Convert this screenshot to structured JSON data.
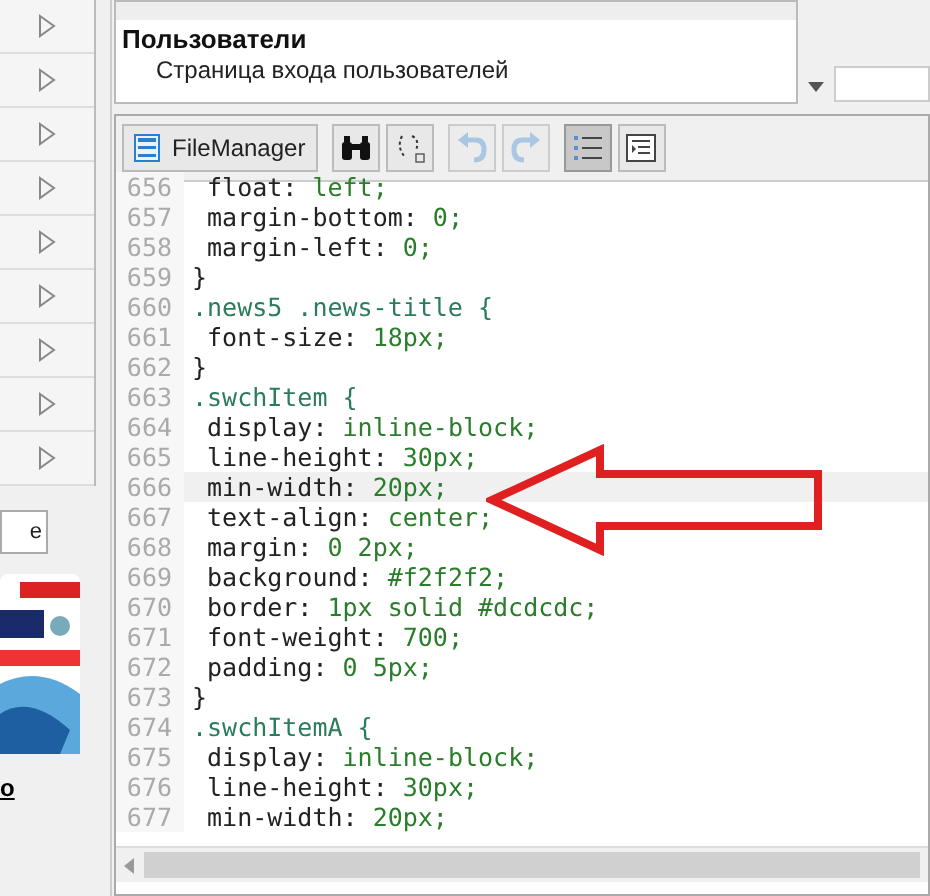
{
  "sidebar": {
    "tab_label": "e",
    "link": "o"
  },
  "pages_list": {
    "items": [
      {
        "kind": "group",
        "text": "Пользователи",
        "selected": false
      },
      {
        "kind": "item",
        "text": "Страница входа пользователей",
        "selected": false
      }
    ]
  },
  "toolbar": {
    "file_manager": "FileManager"
  },
  "editor": {
    "lines": [
      {
        "number": "656",
        "kind": "decl",
        "property": "float:",
        "value": "left;",
        "highlighted": false
      },
      {
        "number": "657",
        "kind": "decl",
        "property": "margin-bottom:",
        "value": "0;",
        "highlighted": false
      },
      {
        "number": "658",
        "kind": "decl",
        "property": "margin-left:",
        "value": "0;",
        "highlighted": false
      },
      {
        "number": "659",
        "kind": "close",
        "text": "}",
        "highlighted": false
      },
      {
        "number": "660",
        "kind": "selector",
        "text": ".news5 .news-title {",
        "highlighted": false
      },
      {
        "number": "661",
        "kind": "decl",
        "property": "font-size:",
        "value": "18px;",
        "highlighted": false
      },
      {
        "number": "662",
        "kind": "close",
        "text": "}",
        "highlighted": false
      },
      {
        "number": "663",
        "kind": "selector",
        "text": ".swchItem {",
        "highlighted": false
      },
      {
        "number": "664",
        "kind": "decl",
        "property": "display:",
        "value": "inline-block;",
        "highlighted": false
      },
      {
        "number": "665",
        "kind": "decl",
        "property": "line-height:",
        "value": "30px;",
        "highlighted": false
      },
      {
        "number": "666",
        "kind": "decl",
        "property": "min-width:",
        "value": "20px;",
        "highlighted": true
      },
      {
        "number": "667",
        "kind": "decl",
        "property": "text-align:",
        "value": "center;",
        "highlighted": false
      },
      {
        "number": "668",
        "kind": "decl",
        "property": "margin:",
        "value": "0 2px;",
        "highlighted": false
      },
      {
        "number": "669",
        "kind": "decl",
        "property": "background:",
        "value": "#f2f2f2;",
        "highlighted": false
      },
      {
        "number": "670",
        "kind": "decl",
        "property": "border:",
        "value": "1px solid #dcdcdc;",
        "highlighted": false
      },
      {
        "number": "671",
        "kind": "decl",
        "property": "font-weight:",
        "value": "700;",
        "highlighted": false
      },
      {
        "number": "672",
        "kind": "decl",
        "property": "padding:",
        "value": "0 5px;",
        "highlighted": false
      },
      {
        "number": "673",
        "kind": "close",
        "text": "}",
        "highlighted": false
      },
      {
        "number": "674",
        "kind": "selector",
        "text": ".swchItemA {",
        "highlighted": false
      },
      {
        "number": "675",
        "kind": "decl",
        "property": "display:",
        "value": "inline-block;",
        "highlighted": false
      },
      {
        "number": "676",
        "kind": "decl",
        "property": "line-height:",
        "value": "30px;",
        "highlighted": false
      },
      {
        "number": "677",
        "kind": "decl",
        "property": "min-width:",
        "value": "20px;",
        "highlighted": false
      }
    ]
  }
}
